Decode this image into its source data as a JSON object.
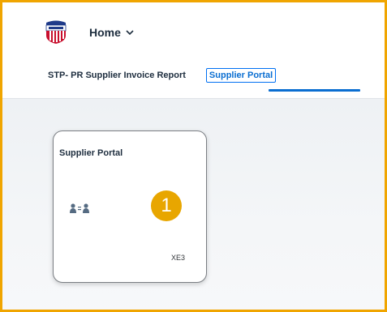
{
  "header": {
    "home_label": "Home",
    "logo_icon": "union-pacific-shield-icon",
    "dropdown_icon": "chevron-down-icon"
  },
  "tabs": [
    {
      "label": "STP- PR Supplier Invoice Report",
      "selected": false
    },
    {
      "label": "Supplier Portal",
      "selected": true
    }
  ],
  "tile": {
    "title": "Supplier Portal",
    "icon": "supplier-exchange-icon",
    "footer": "XE3"
  },
  "callout": {
    "number": "1"
  },
  "colors": {
    "frame_border": "#f0a500",
    "callout": "#e8a600",
    "accent": "#0a6ed1",
    "text": "#1d2d3e"
  }
}
